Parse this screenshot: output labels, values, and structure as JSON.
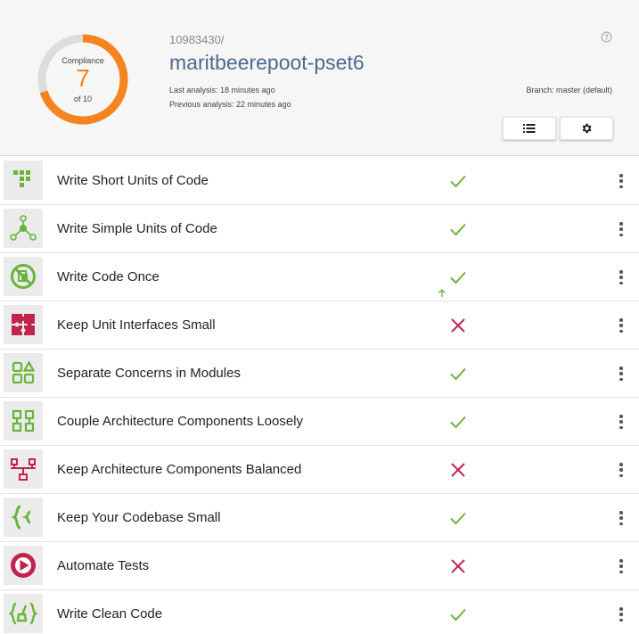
{
  "compliance": {
    "title": "Compliance",
    "value": "7",
    "of_label": "of 10",
    "score_fraction": 0.7,
    "ring_color": "#f5841f",
    "track_color": "#dddddd"
  },
  "repo": {
    "id": "10983430/",
    "name": "maritbeerepoot-pset6"
  },
  "analysis": {
    "last": "Last analysis: 18 minutes ago",
    "previous": "Previous analysis: 22 minutes ago",
    "branch": "Branch: master (default)"
  },
  "icons": {
    "help": "help-circle-icon",
    "list": "list-icon",
    "settings": "gear-icon",
    "pass": "checkmark-icon",
    "fail": "cross-icon",
    "menu": "more-vertical-icon",
    "trend": "arrow-up-icon"
  },
  "colors": {
    "pass": "#6bb43a",
    "fail": "#c0234e",
    "green_icon": "#6bb43a",
    "red_icon": "#c0234e"
  },
  "guidelines": [
    {
      "label": "Write Short Units of Code",
      "status": "pass",
      "icon": "short-units-icon",
      "icon_color": "green"
    },
    {
      "label": "Write Simple Units of Code",
      "status": "pass",
      "icon": "simple-units-icon",
      "icon_color": "green"
    },
    {
      "label": "Write Code Once",
      "status": "pass",
      "icon": "code-once-icon",
      "icon_color": "green",
      "trend": "up"
    },
    {
      "label": "Keep Unit Interfaces Small",
      "status": "fail",
      "icon": "puzzle-icon",
      "icon_color": "red"
    },
    {
      "label": "Separate Concerns in Modules",
      "status": "pass",
      "icon": "modules-icon",
      "icon_color": "green"
    },
    {
      "label": "Couple Architecture Components Loosely",
      "status": "pass",
      "icon": "components-icon",
      "icon_color": "green"
    },
    {
      "label": "Keep Architecture Components Balanced",
      "status": "fail",
      "icon": "balance-icon",
      "icon_color": "red"
    },
    {
      "label": "Keep Your Codebase Small",
      "status": "pass",
      "icon": "braces-icon",
      "icon_color": "green"
    },
    {
      "label": "Automate Tests",
      "status": "fail",
      "icon": "play-icon",
      "icon_color": "red"
    },
    {
      "label": "Write Clean Code",
      "status": "pass",
      "icon": "broom-icon",
      "icon_color": "green"
    }
  ]
}
